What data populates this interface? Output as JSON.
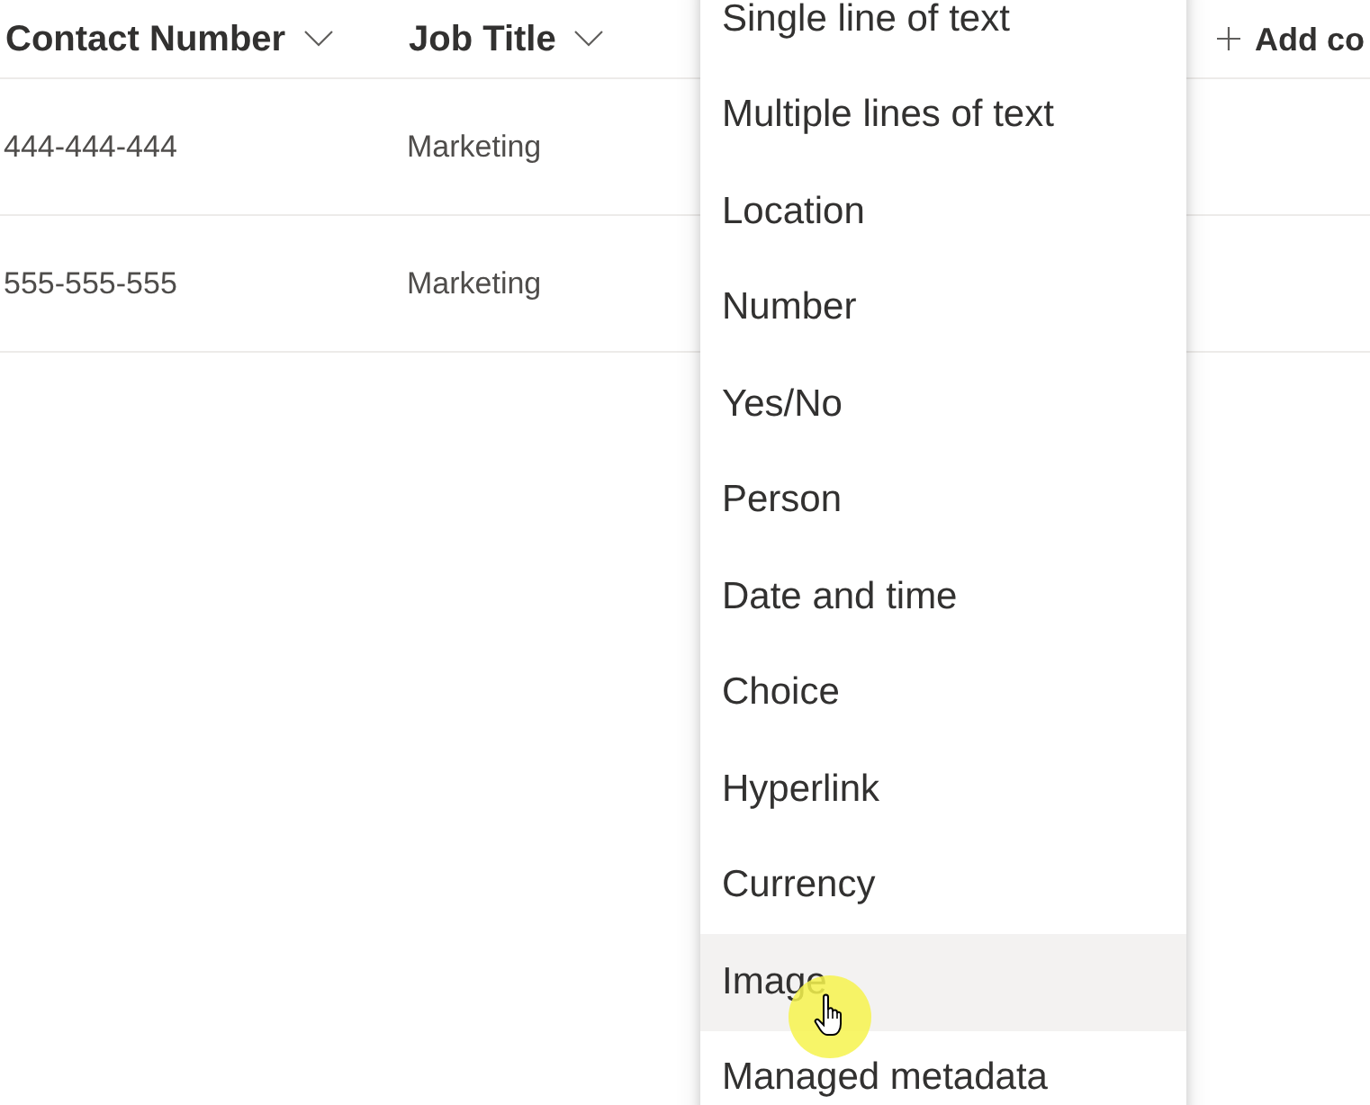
{
  "table": {
    "columns": [
      {
        "kind": "column",
        "label": "Contact Number"
      },
      {
        "kind": "column",
        "label": "Job Title"
      },
      {
        "kind": "add",
        "label": "Add co"
      }
    ],
    "rows": [
      {
        "cells": [
          "444-444-444",
          "Marketing"
        ]
      },
      {
        "cells": [
          "555-555-555",
          "Marketing"
        ]
      }
    ]
  },
  "column_type_menu": {
    "items": [
      {
        "label": "Single line of text",
        "highlighted": false
      },
      {
        "label": "Multiple lines of text",
        "highlighted": false
      },
      {
        "label": "Location",
        "highlighted": false
      },
      {
        "label": "Number",
        "highlighted": false
      },
      {
        "label": "Yes/No",
        "highlighted": false
      },
      {
        "label": "Person",
        "highlighted": false
      },
      {
        "label": "Date and time",
        "highlighted": false
      },
      {
        "label": "Choice",
        "highlighted": false
      },
      {
        "label": "Hyperlink",
        "highlighted": false
      },
      {
        "label": "Currency",
        "highlighted": false
      },
      {
        "label": "Image",
        "highlighted": true
      },
      {
        "label": "Managed metadata",
        "highlighted": false
      }
    ]
  }
}
